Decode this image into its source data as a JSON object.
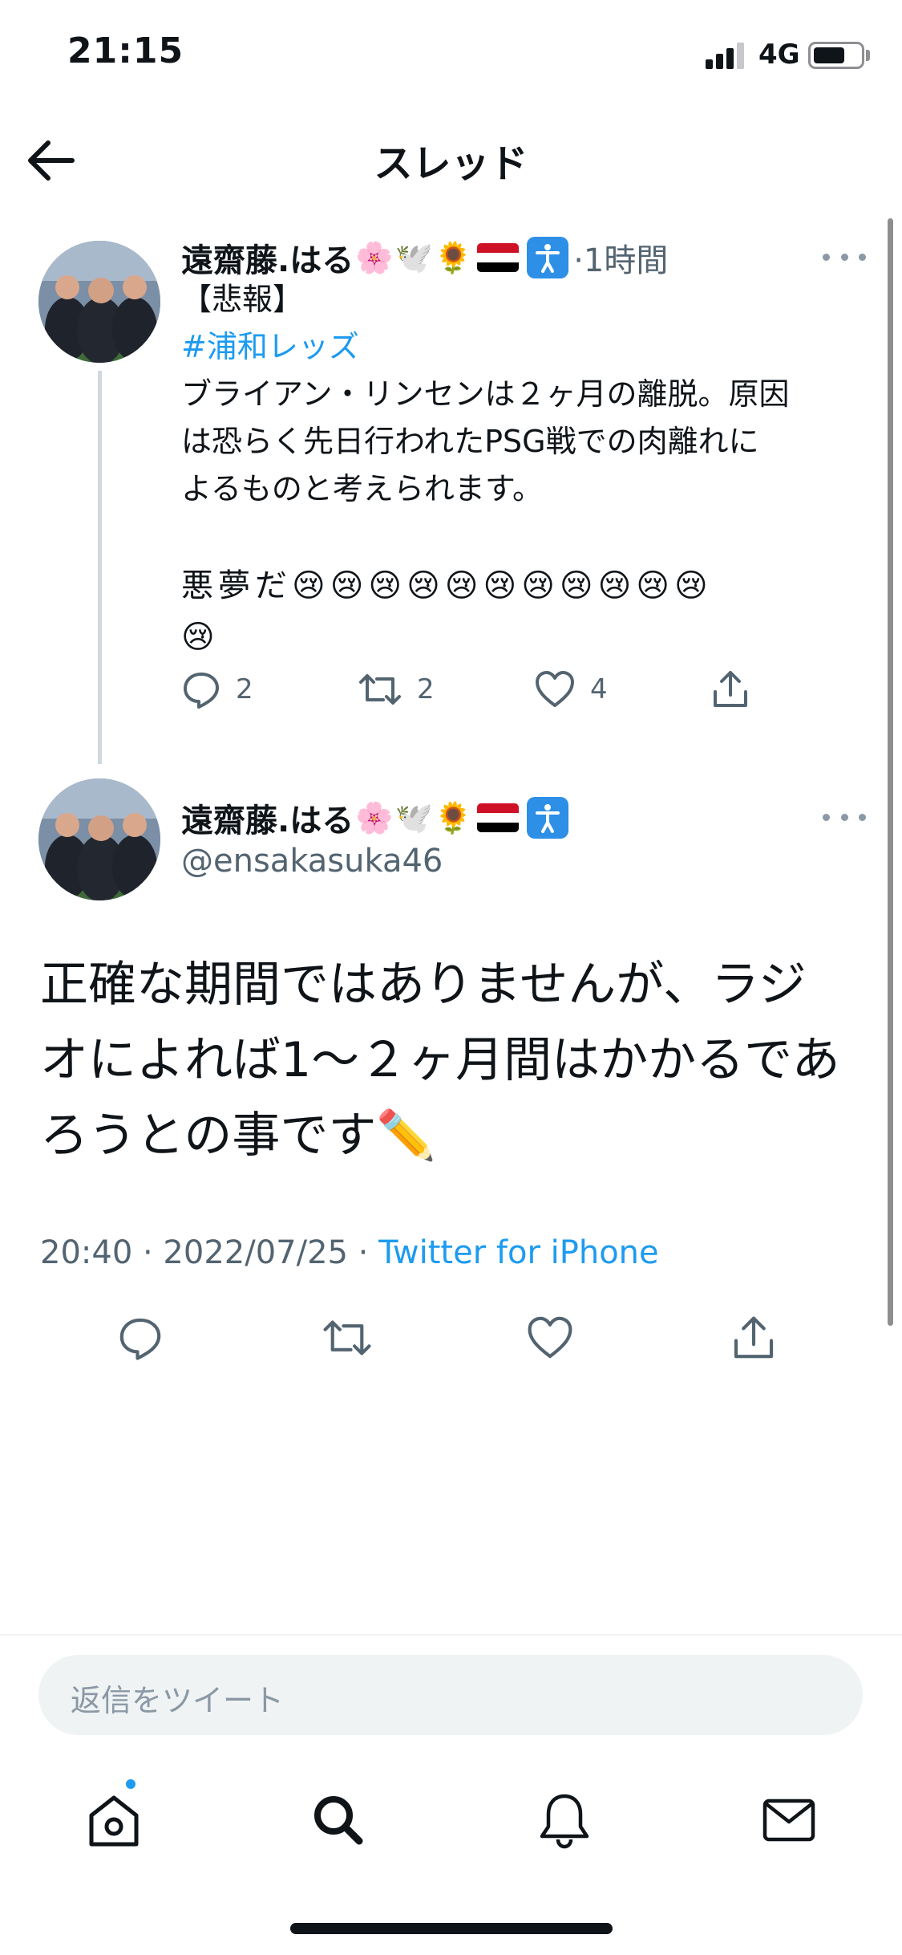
{
  "status_bar": {
    "time": "21:15",
    "network": "4G",
    "battery_level": 0.65
  },
  "header": {
    "title": "スレッド",
    "back_icon": "arrow-left-icon"
  },
  "colors": {
    "link": "#1d9bf0",
    "secondary_text": "#536471",
    "primary_text": "#0f1419"
  },
  "tweet1": {
    "display_name": "遠齋藤.はる",
    "name_emojis": [
      "🌸",
      "🕊️",
      "🌻"
    ],
    "time": "·1時間",
    "lines": [
      "【悲報】",
      "#浦和レッズ",
      "ブライアン・リンセンは２ヶ月の離脱。原因",
      "は恐らく先日行われたPSG戦での肉離れに",
      "よるものと考えられます。",
      "",
      "悪夢だ😢😢😢😢😢😢😢😢😢😢😢",
      "😢"
    ],
    "actions": {
      "reply_count": "2",
      "retweet_count": "2",
      "like_count": "4"
    }
  },
  "tweet2": {
    "display_name": "遠齋藤.はる",
    "name_emojis": [
      "🌸",
      "🕊️",
      "🌻"
    ],
    "handle": "@ensakasuka46",
    "lines": [
      "正確な期間ではありませんが、ラジ",
      "オによれば1〜２ヶ月間はかかるであ",
      "ろうとの事です✏️"
    ],
    "timestamp": "20:40 · 2022/07/25 · ",
    "source": "Twitter for iPhone"
  },
  "reply": {
    "placeholder": "返信をツイート"
  },
  "tab_bar": {
    "items": [
      "home-icon",
      "search-icon",
      "notifications-icon",
      "messages-icon"
    ]
  }
}
